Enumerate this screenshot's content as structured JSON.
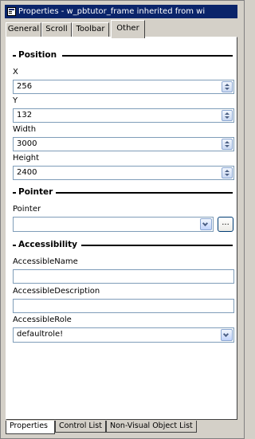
{
  "window": {
    "title": "Properties - w_pbtutor_frame  inherited  from  wi"
  },
  "tabs": [
    {
      "label": "General"
    },
    {
      "label": "Scroll"
    },
    {
      "label": "Toolbar"
    },
    {
      "label": "Other",
      "active": true
    }
  ],
  "sections": {
    "position": "Position",
    "pointer": "Pointer",
    "accessibility": "Accessibility"
  },
  "fields": {
    "x": {
      "label": "X",
      "value": "256"
    },
    "y": {
      "label": "Y",
      "value": "132"
    },
    "width": {
      "label": "Width",
      "value": "3000"
    },
    "height": {
      "label": "Height",
      "value": "2400"
    },
    "pointer": {
      "label": "Pointer",
      "value": "",
      "browse_label": "..."
    },
    "accessible_name": {
      "label": "AccessibleName",
      "value": ""
    },
    "accessible_description": {
      "label": "AccessibleDescription",
      "value": ""
    },
    "accessible_role": {
      "label": "AccessibleRole",
      "value": "defaultrole!"
    }
  },
  "bottom_tabs": [
    {
      "label": "Properties",
      "active": true
    },
    {
      "label": "Control List"
    },
    {
      "label": "Non-Visual Object List"
    }
  ],
  "colors": {
    "title_bar": "#0a246a",
    "window_face": "#d4d0c8",
    "panel": "#ffffff",
    "field_border": "#7f9db9"
  },
  "icons": {
    "title_icon": "properties-window-icon",
    "spin": "spin-up-down-icon",
    "dropdown": "chevron-down-icon"
  }
}
